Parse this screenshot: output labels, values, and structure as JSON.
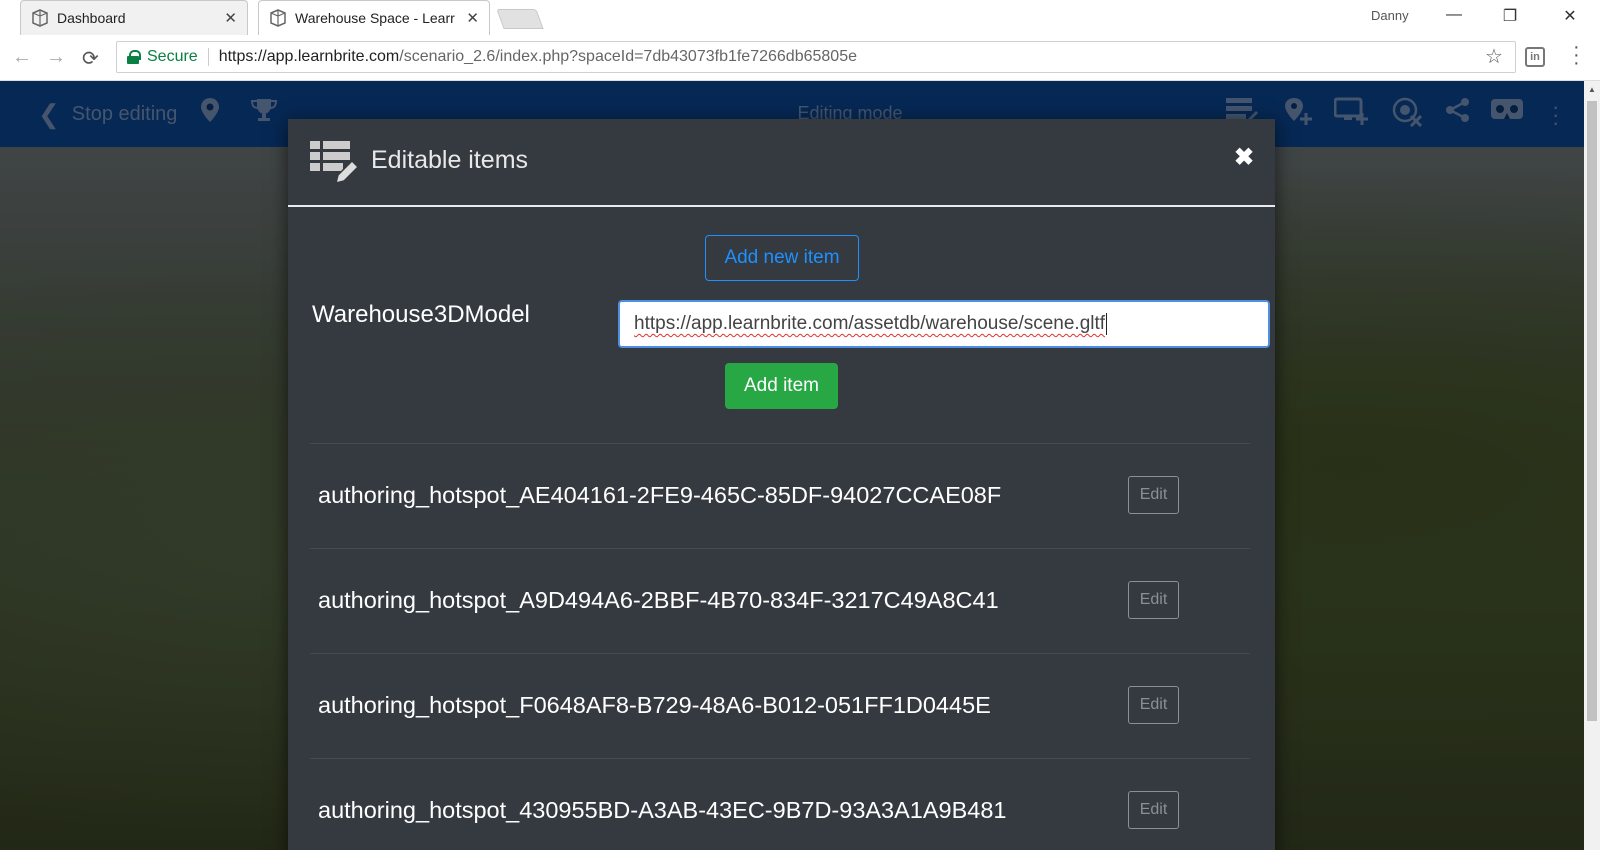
{
  "browser": {
    "tabs": [
      {
        "title": "Dashboard",
        "close": "✕"
      },
      {
        "title": "Warehouse Space - Learr",
        "close": "✕"
      }
    ],
    "profile_name": "Danny",
    "window_controls": {
      "minimize": "—",
      "restore": "❐",
      "close": "✕"
    },
    "address": {
      "secure_label": "Secure",
      "url_host": "https://app.learnbrite.com",
      "url_path": "/scenario_2.6/index.php?spaceId=7db43073fb1fe7266db65805e"
    },
    "extension_label": "in"
  },
  "appbar": {
    "stop_editing_label": "Stop editing",
    "mode_label": "Editing mode"
  },
  "modal": {
    "title": "Editable items",
    "close_glyph": "✖",
    "add_new_label": "Add new item",
    "new_item_name": "Warehouse3DModel",
    "new_item_url": "https://app.learnbrite.com/assetdb/warehouse/scene.gltf",
    "add_item_label": "Add item",
    "items": [
      {
        "name": "authoring_hotspot_AE404161-2FE9-465C-85DF-94027CCAE08F",
        "edit_label": "Edit"
      },
      {
        "name": "authoring_hotspot_A9D494A6-2BBF-4B70-834F-3217C49A8C41",
        "edit_label": "Edit"
      },
      {
        "name": "authoring_hotspot_F0648AF8-B729-48A6-B012-051FF1D0445E",
        "edit_label": "Edit"
      },
      {
        "name": "authoring_hotspot_430955BD-A3AB-43EC-9B7D-93A3A1A9B481",
        "edit_label": "Edit"
      }
    ]
  },
  "colors": {
    "appbar": "#0b4a9a",
    "modal_bg": "#343a40",
    "primary": "#1e90ff",
    "success": "#28a745",
    "secure": "#0b8043"
  }
}
